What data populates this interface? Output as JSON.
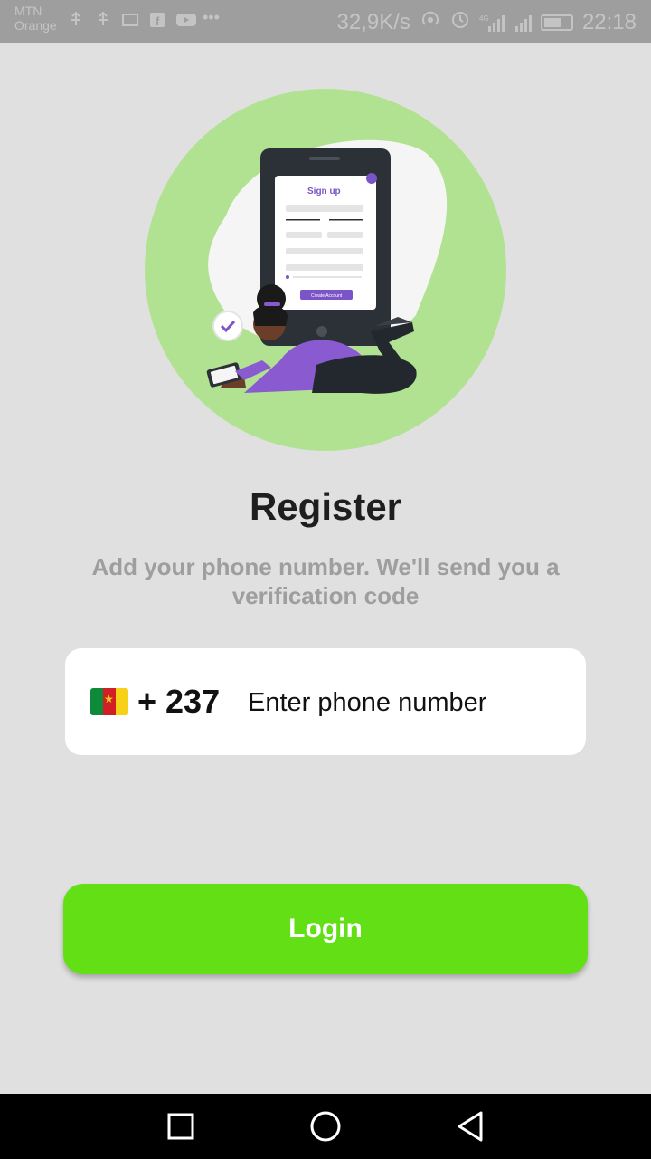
{
  "status_bar": {
    "carrier_1": "MTN",
    "carrier_2": "Orange",
    "speed": "32,9K/s",
    "time": "22:18",
    "network": "4G"
  },
  "hero": {
    "illustration": "woman-registering-illustration",
    "card_title": "Sign up",
    "card_button": "Create Account",
    "circle_color": "#b1e291"
  },
  "register": {
    "title": "Register",
    "subtitle": "Add your phone number. We'll send you a verification code"
  },
  "phone": {
    "country_flag": "cameroon-flag",
    "country_code": "+ 237",
    "placeholder": "Enter phone number",
    "value": ""
  },
  "actions": {
    "login_label": "Login",
    "accent": "#62e015"
  },
  "nav": {
    "recents": "square-icon",
    "home": "circle-icon",
    "back": "triangle-back-icon"
  }
}
